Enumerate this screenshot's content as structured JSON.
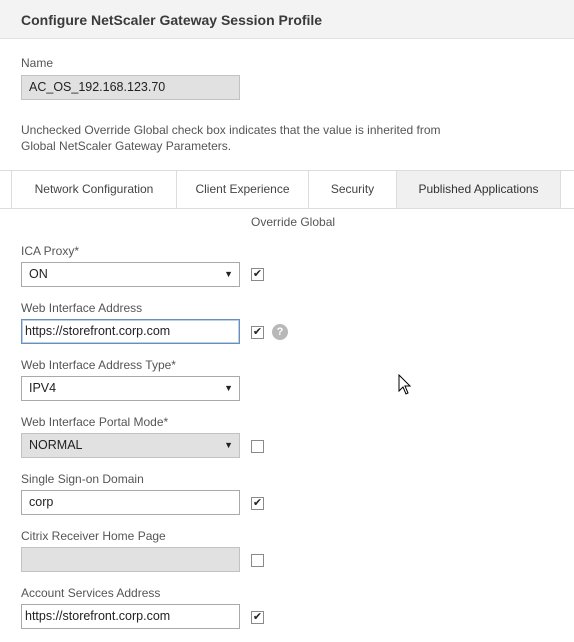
{
  "header": {
    "title": "Configure NetScaler Gateway Session Profile"
  },
  "name_field": {
    "label": "Name",
    "value": "AC_OS_192.168.123.70"
  },
  "info_text": {
    "line1": "Unchecked Override Global check box indicates that the value is inherited from",
    "line2": "Global NetScaler Gateway Parameters."
  },
  "tabs": [
    {
      "label": "Network Configuration"
    },
    {
      "label": "Client Experience"
    },
    {
      "label": "Security"
    },
    {
      "label": "Published Applications",
      "active": true
    }
  ],
  "override_header": "Override Global",
  "fields": {
    "ica_proxy": {
      "label": "ICA Proxy*",
      "value": "ON",
      "override": true
    },
    "web_interface_address": {
      "label": "Web Interface Address",
      "value": "https://storefront.corp.com",
      "override": true,
      "help_icon": "?"
    },
    "web_interface_address_type": {
      "label": "Web Interface Address Type*",
      "value": "IPV4",
      "override": true
    },
    "web_interface_portal_mode": {
      "label": "Web Interface Portal Mode*",
      "value": "NORMAL",
      "override": false
    },
    "single_sign_on_domain": {
      "label": "Single Sign-on Domain",
      "value": "corp",
      "override": true
    },
    "citrix_receiver_home_page": {
      "label": "Citrix Receiver Home Page",
      "value": "",
      "override": false
    },
    "account_services_address": {
      "label": "Account Services Address",
      "value": "https://storefront.corp.com",
      "override": true
    }
  },
  "icons": {
    "checkmark": "✔",
    "dropdown": "▼"
  }
}
